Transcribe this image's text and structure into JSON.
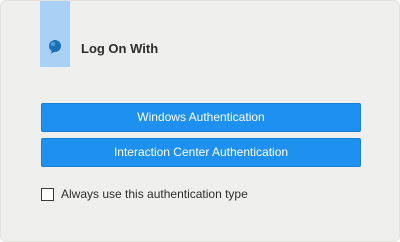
{
  "dialog": {
    "title": "Log On With",
    "brand_icon": "speech-bubble-icon",
    "accent_color": "#1e90f0",
    "tab_color": "#a9d0f5"
  },
  "buttons": {
    "windows_auth": "Windows Authentication",
    "ic_auth": "Interaction Center Authentication"
  },
  "options": {
    "always_use_label": "Always use this authentication type",
    "always_use_checked": false
  }
}
